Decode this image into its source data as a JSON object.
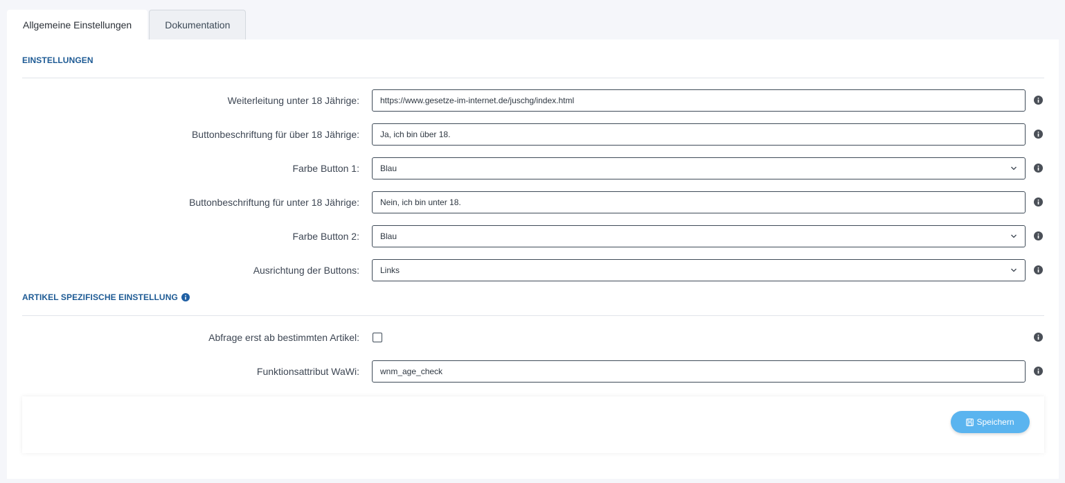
{
  "tabs": [
    {
      "label": "Allgemeine Einstellungen",
      "active": true
    },
    {
      "label": "Dokumentation",
      "active": false
    }
  ],
  "sections": {
    "einstellungen": "EINSTELLUNGEN",
    "artikel": "ARTIKEL SPEZIFISCHE EINSTELLUNG"
  },
  "fields": {
    "redirect": {
      "label": "Weiterleitung unter 18 Jährige:",
      "value": "https://www.gesetze-im-internet.de/juschg/index.html"
    },
    "button_over": {
      "label": "Buttonbeschriftung für über 18 Jährige:",
      "value": "Ja, ich bin über 18."
    },
    "color1": {
      "label": "Farbe Button 1:",
      "value": "Blau"
    },
    "button_under": {
      "label": "Buttonbeschriftung für unter 18 Jährige:",
      "value": "Nein, ich bin unter 18."
    },
    "color2": {
      "label": "Farbe Button 2:",
      "value": "Blau"
    },
    "alignment": {
      "label": "Ausrichtung der Buttons:",
      "value": "Links"
    },
    "article_check": {
      "label": "Abfrage erst ab bestimmten Artikel:",
      "checked": false
    },
    "wawi_attr": {
      "label": "Funktionsattribut WaWi:",
      "value": "wnm_age_check"
    }
  },
  "save_label": "Speichern",
  "icons": {
    "info": "info-circle-icon",
    "chevron": "chevron-down-icon",
    "save": "floppy-disk-icon"
  },
  "colors": {
    "accent": "#1d5a94",
    "button": "#5ab4ef",
    "info": "#4a4f57",
    "info_blue": "#1f5fa3"
  }
}
